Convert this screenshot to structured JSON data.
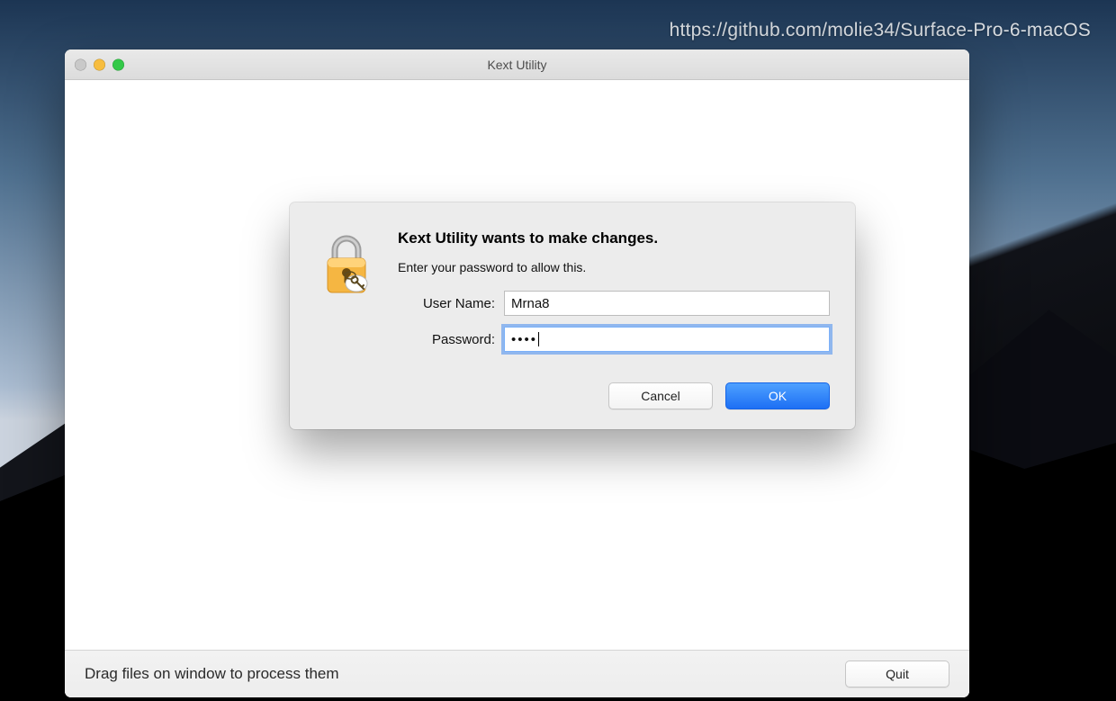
{
  "watermark": "https://github.com/molie34/Surface-Pro-6-macOS",
  "window": {
    "title": "Kext Utility"
  },
  "footer": {
    "hint": "Drag files on window to process them",
    "quit_label": "Quit"
  },
  "auth": {
    "heading": "Kext Utility wants to make changes.",
    "subtext": "Enter your password to allow this.",
    "username_label": "User Name:",
    "password_label": "Password:",
    "username_value": "Mrna8",
    "password_value": "••••",
    "cancel_label": "Cancel",
    "ok_label": "OK",
    "lock_icon_name": "lock-keys-icon"
  }
}
